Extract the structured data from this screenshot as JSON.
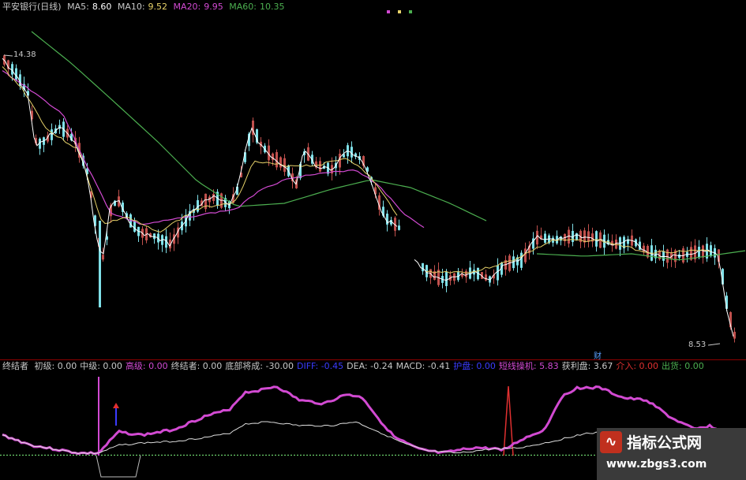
{
  "header": {
    "title": "平安银行(日线)",
    "ma5_label": "MA5:",
    "ma5": "8.60",
    "ma10_label": "MA10:",
    "ma10": "9.52",
    "ma20_label": "MA20:",
    "ma20": "9.95",
    "ma60_label": "MA60:",
    "ma60": "10.35"
  },
  "colors": {
    "up": "#c0504d",
    "down": "#7fe0e8",
    "ma5": "#ffffff",
    "ma10": "#e8d36a",
    "ma20": "#d24ad2",
    "ma60": "#4caf50",
    "grid": "#8b0000"
  },
  "price_labels": {
    "high": "14.38",
    "low": "8.53",
    "fin": "财"
  },
  "indicator": {
    "name": "终结者",
    "items": [
      {
        "label": "初级:",
        "value": "0.00",
        "color": "#c8c8c8"
      },
      {
        "label": "中级:",
        "value": "0.00",
        "color": "#c8c8c8"
      },
      {
        "label": "高级:",
        "value": "0.00",
        "color": "#d24ad2"
      },
      {
        "label": "终结者:",
        "value": "0.00",
        "color": "#c8c8c8"
      },
      {
        "label": "底部将成:",
        "value": "-30.00",
        "color": "#c8c8c8"
      },
      {
        "label": "DIFF:",
        "value": "-0.45",
        "color": "#3b3bff"
      },
      {
        "label": "DEA:",
        "value": "-0.24",
        "color": "#c8c8c8"
      },
      {
        "label": "MACD:",
        "value": "-0.41",
        "color": "#c8c8c8"
      },
      {
        "label": "护盘:",
        "value": "0.00",
        "color": "#3b3bff"
      },
      {
        "label": "短线操机:",
        "value": "5.83",
        "color": "#d24ad2"
      },
      {
        "label": "获利盘:",
        "value": "3.67",
        "color": "#c8c8c8"
      },
      {
        "label": "介入:",
        "value": "0.00",
        "color": "#e03030"
      },
      {
        "label": "出货:",
        "value": "0.00",
        "color": "#4caf50"
      }
    ]
  },
  "watermark": {
    "logo": "∿",
    "title": "指标公式网",
    "url": "www.zbgs3.com"
  }
}
